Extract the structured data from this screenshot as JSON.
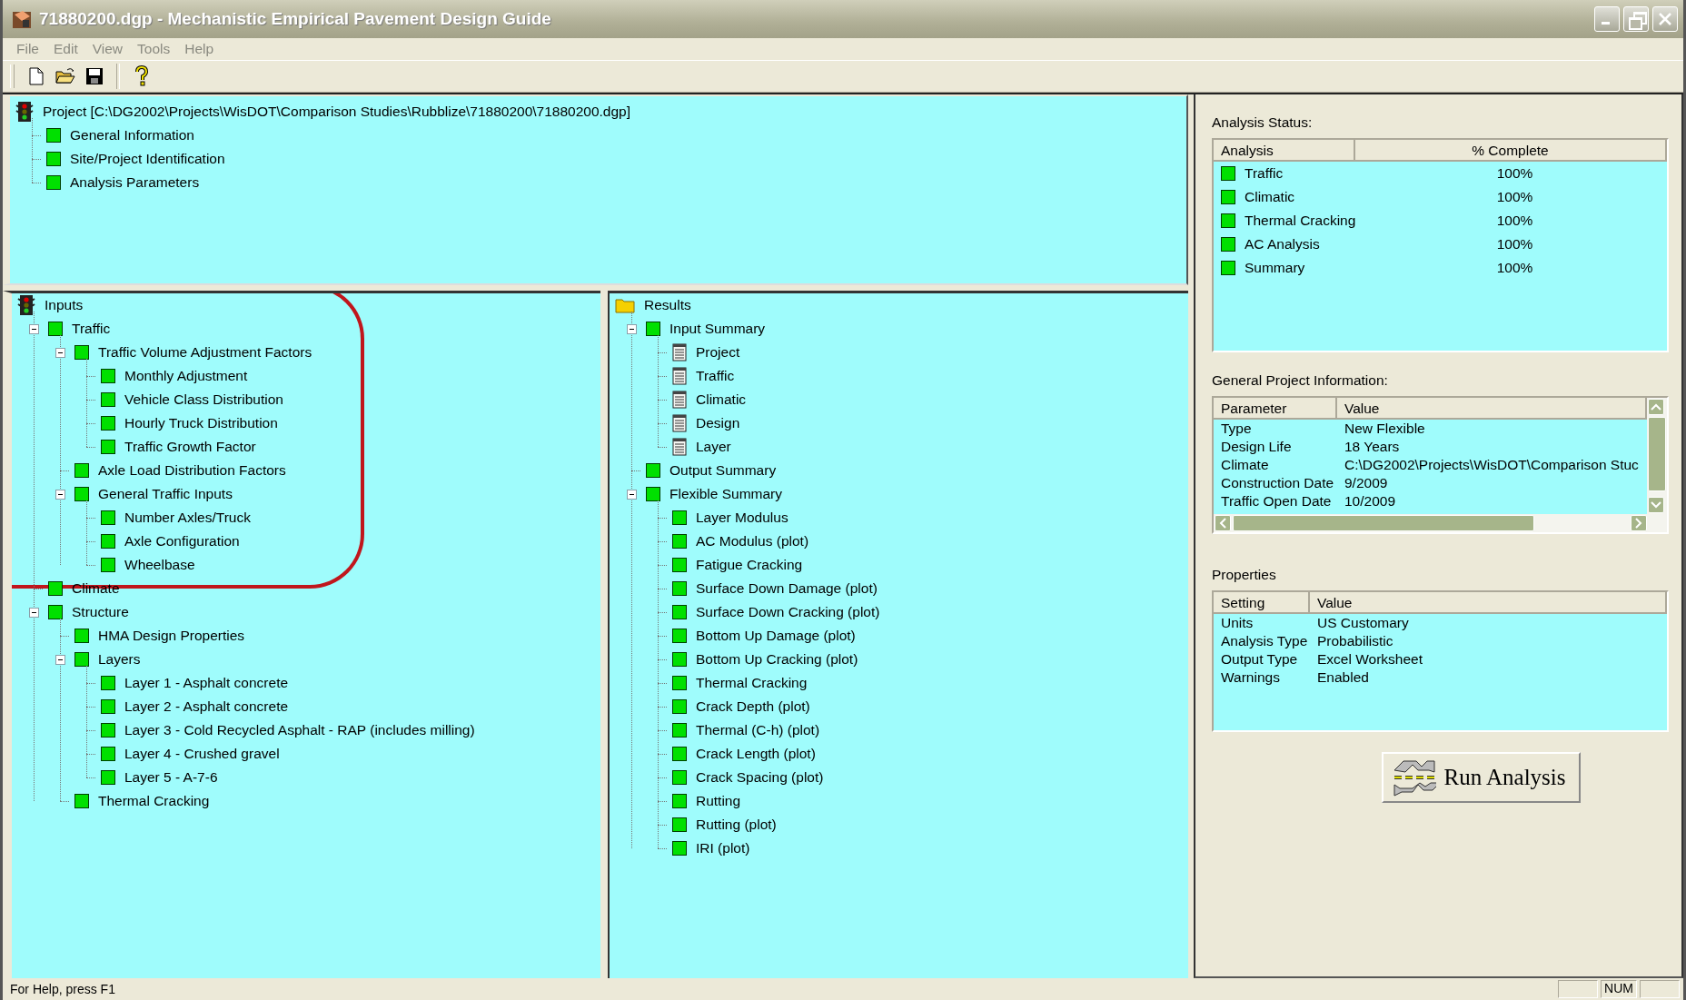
{
  "window": {
    "title": "71880200.dgp - Mechanistic Empirical Pavement Design Guide"
  },
  "menu": [
    "File",
    "Edit",
    "View",
    "Tools",
    "Help"
  ],
  "project_tree": {
    "label": "Project [C:\\DG2002\\Projects\\WisDOT\\Comparison Studies\\Rubblize\\71880200\\71880200.dgp]",
    "kind": "traffic-light",
    "children": [
      {
        "label": "General Information",
        "kind": "status"
      },
      {
        "label": "Site/Project Identification",
        "kind": "status"
      },
      {
        "label": "Analysis Parameters",
        "kind": "status"
      }
    ]
  },
  "inputs_tree": {
    "label": "Inputs",
    "kind": "traffic-light",
    "children": [
      {
        "label": "Traffic",
        "kind": "status",
        "expanded": true,
        "children": [
          {
            "label": "Traffic Volume Adjustment Factors",
            "kind": "status",
            "expanded": true,
            "children": [
              {
                "label": "Monthly Adjustment",
                "kind": "status"
              },
              {
                "label": "Vehicle Class Distribution",
                "kind": "status"
              },
              {
                "label": "Hourly Truck Distribution",
                "kind": "status"
              },
              {
                "label": "Traffic Growth Factor",
                "kind": "status"
              }
            ]
          },
          {
            "label": "Axle Load Distribution Factors",
            "kind": "status"
          },
          {
            "label": "General Traffic Inputs",
            "kind": "status",
            "expanded": true,
            "children": [
              {
                "label": "Number Axles/Truck",
                "kind": "status"
              },
              {
                "label": "Axle Configuration",
                "kind": "status"
              },
              {
                "label": "Wheelbase",
                "kind": "status"
              }
            ]
          }
        ]
      },
      {
        "label": "Climate",
        "kind": "status"
      },
      {
        "label": "Structure",
        "kind": "status",
        "expanded": true,
        "children": [
          {
            "label": "HMA Design Properties",
            "kind": "status"
          },
          {
            "label": "Layers",
            "kind": "status",
            "expanded": true,
            "children": [
              {
                "label": "Layer 1 - Asphalt concrete",
                "kind": "status"
              },
              {
                "label": "Layer 2 - Asphalt concrete",
                "kind": "status"
              },
              {
                "label": "Layer 3 - Cold Recycled Asphalt - RAP (includes milling)",
                "kind": "status"
              },
              {
                "label": "Layer 4 - Crushed gravel",
                "kind": "status"
              },
              {
                "label": "Layer 5 - A-7-6",
                "kind": "status"
              }
            ]
          },
          {
            "label": "Thermal Cracking",
            "kind": "status"
          }
        ]
      }
    ]
  },
  "results_tree": {
    "label": "Results",
    "kind": "folder",
    "children": [
      {
        "label": "Input Summary",
        "kind": "status",
        "expanded": true,
        "children": [
          {
            "label": "Project",
            "kind": "document"
          },
          {
            "label": "Traffic",
            "kind": "document"
          },
          {
            "label": "Climatic",
            "kind": "document"
          },
          {
            "label": "Design",
            "kind": "document"
          },
          {
            "label": "Layer",
            "kind": "document"
          }
        ]
      },
      {
        "label": "Output Summary",
        "kind": "status"
      },
      {
        "label": "Flexible Summary",
        "kind": "status",
        "expanded": true,
        "children": [
          {
            "label": "Layer Modulus",
            "kind": "status"
          },
          {
            "label": "AC Modulus (plot)",
            "kind": "status"
          },
          {
            "label": "Fatigue Cracking",
            "kind": "status"
          },
          {
            "label": "Surface Down Damage (plot)",
            "kind": "status"
          },
          {
            "label": "Surface Down Cracking (plot)",
            "kind": "status"
          },
          {
            "label": "Bottom Up Damage (plot)",
            "kind": "status"
          },
          {
            "label": "Bottom Up Cracking (plot)",
            "kind": "status"
          },
          {
            "label": "Thermal Cracking",
            "kind": "status"
          },
          {
            "label": "Crack Depth (plot)",
            "kind": "status"
          },
          {
            "label": "Thermal (C-h) (plot)",
            "kind": "status"
          },
          {
            "label": "Crack Length (plot)",
            "kind": "status"
          },
          {
            "label": "Crack Spacing (plot)",
            "kind": "status"
          },
          {
            "label": "Rutting",
            "kind": "status"
          },
          {
            "label": "Rutting (plot)",
            "kind": "status"
          },
          {
            "label": "IRI (plot)",
            "kind": "status"
          }
        ]
      }
    ]
  },
  "analysis_status": {
    "title": "Analysis Status:",
    "columns": [
      "Analysis",
      "% Complete"
    ],
    "rows": [
      {
        "analysis": "Traffic",
        "complete": "100%"
      },
      {
        "analysis": "Climatic",
        "complete": "100%"
      },
      {
        "analysis": "Thermal Cracking",
        "complete": "100%"
      },
      {
        "analysis": "AC Analysis",
        "complete": "100%"
      },
      {
        "analysis": "Summary",
        "complete": "100%"
      }
    ]
  },
  "project_info": {
    "title": "General Project Information:",
    "columns": [
      "Parameter",
      "Value"
    ],
    "rows": [
      {
        "parameter": "Type",
        "value": "New Flexible"
      },
      {
        "parameter": "Design Life",
        "value": "18 Years"
      },
      {
        "parameter": "Climate",
        "value": "C:\\DG2002\\Projects\\WisDOT\\Comparison Stuc"
      },
      {
        "parameter": "Construction Date",
        "value": "9/2009"
      },
      {
        "parameter": "Traffic Open Date",
        "value": "10/2009"
      }
    ]
  },
  "properties": {
    "title": "Properties",
    "columns": [
      "Setting",
      "Value"
    ],
    "rows": [
      {
        "setting": "Units",
        "value": "US Customary"
      },
      {
        "setting": "Analysis Type",
        "value": "Probabilistic"
      },
      {
        "setting": "Output Type",
        "value": "Excel Worksheet"
      },
      {
        "setting": "Warnings",
        "value": "Enabled"
      }
    ]
  },
  "run_button": {
    "label": "Run Analysis"
  },
  "status_bar": {
    "text": "For Help, press F1",
    "indicators": [
      "NUM"
    ]
  }
}
